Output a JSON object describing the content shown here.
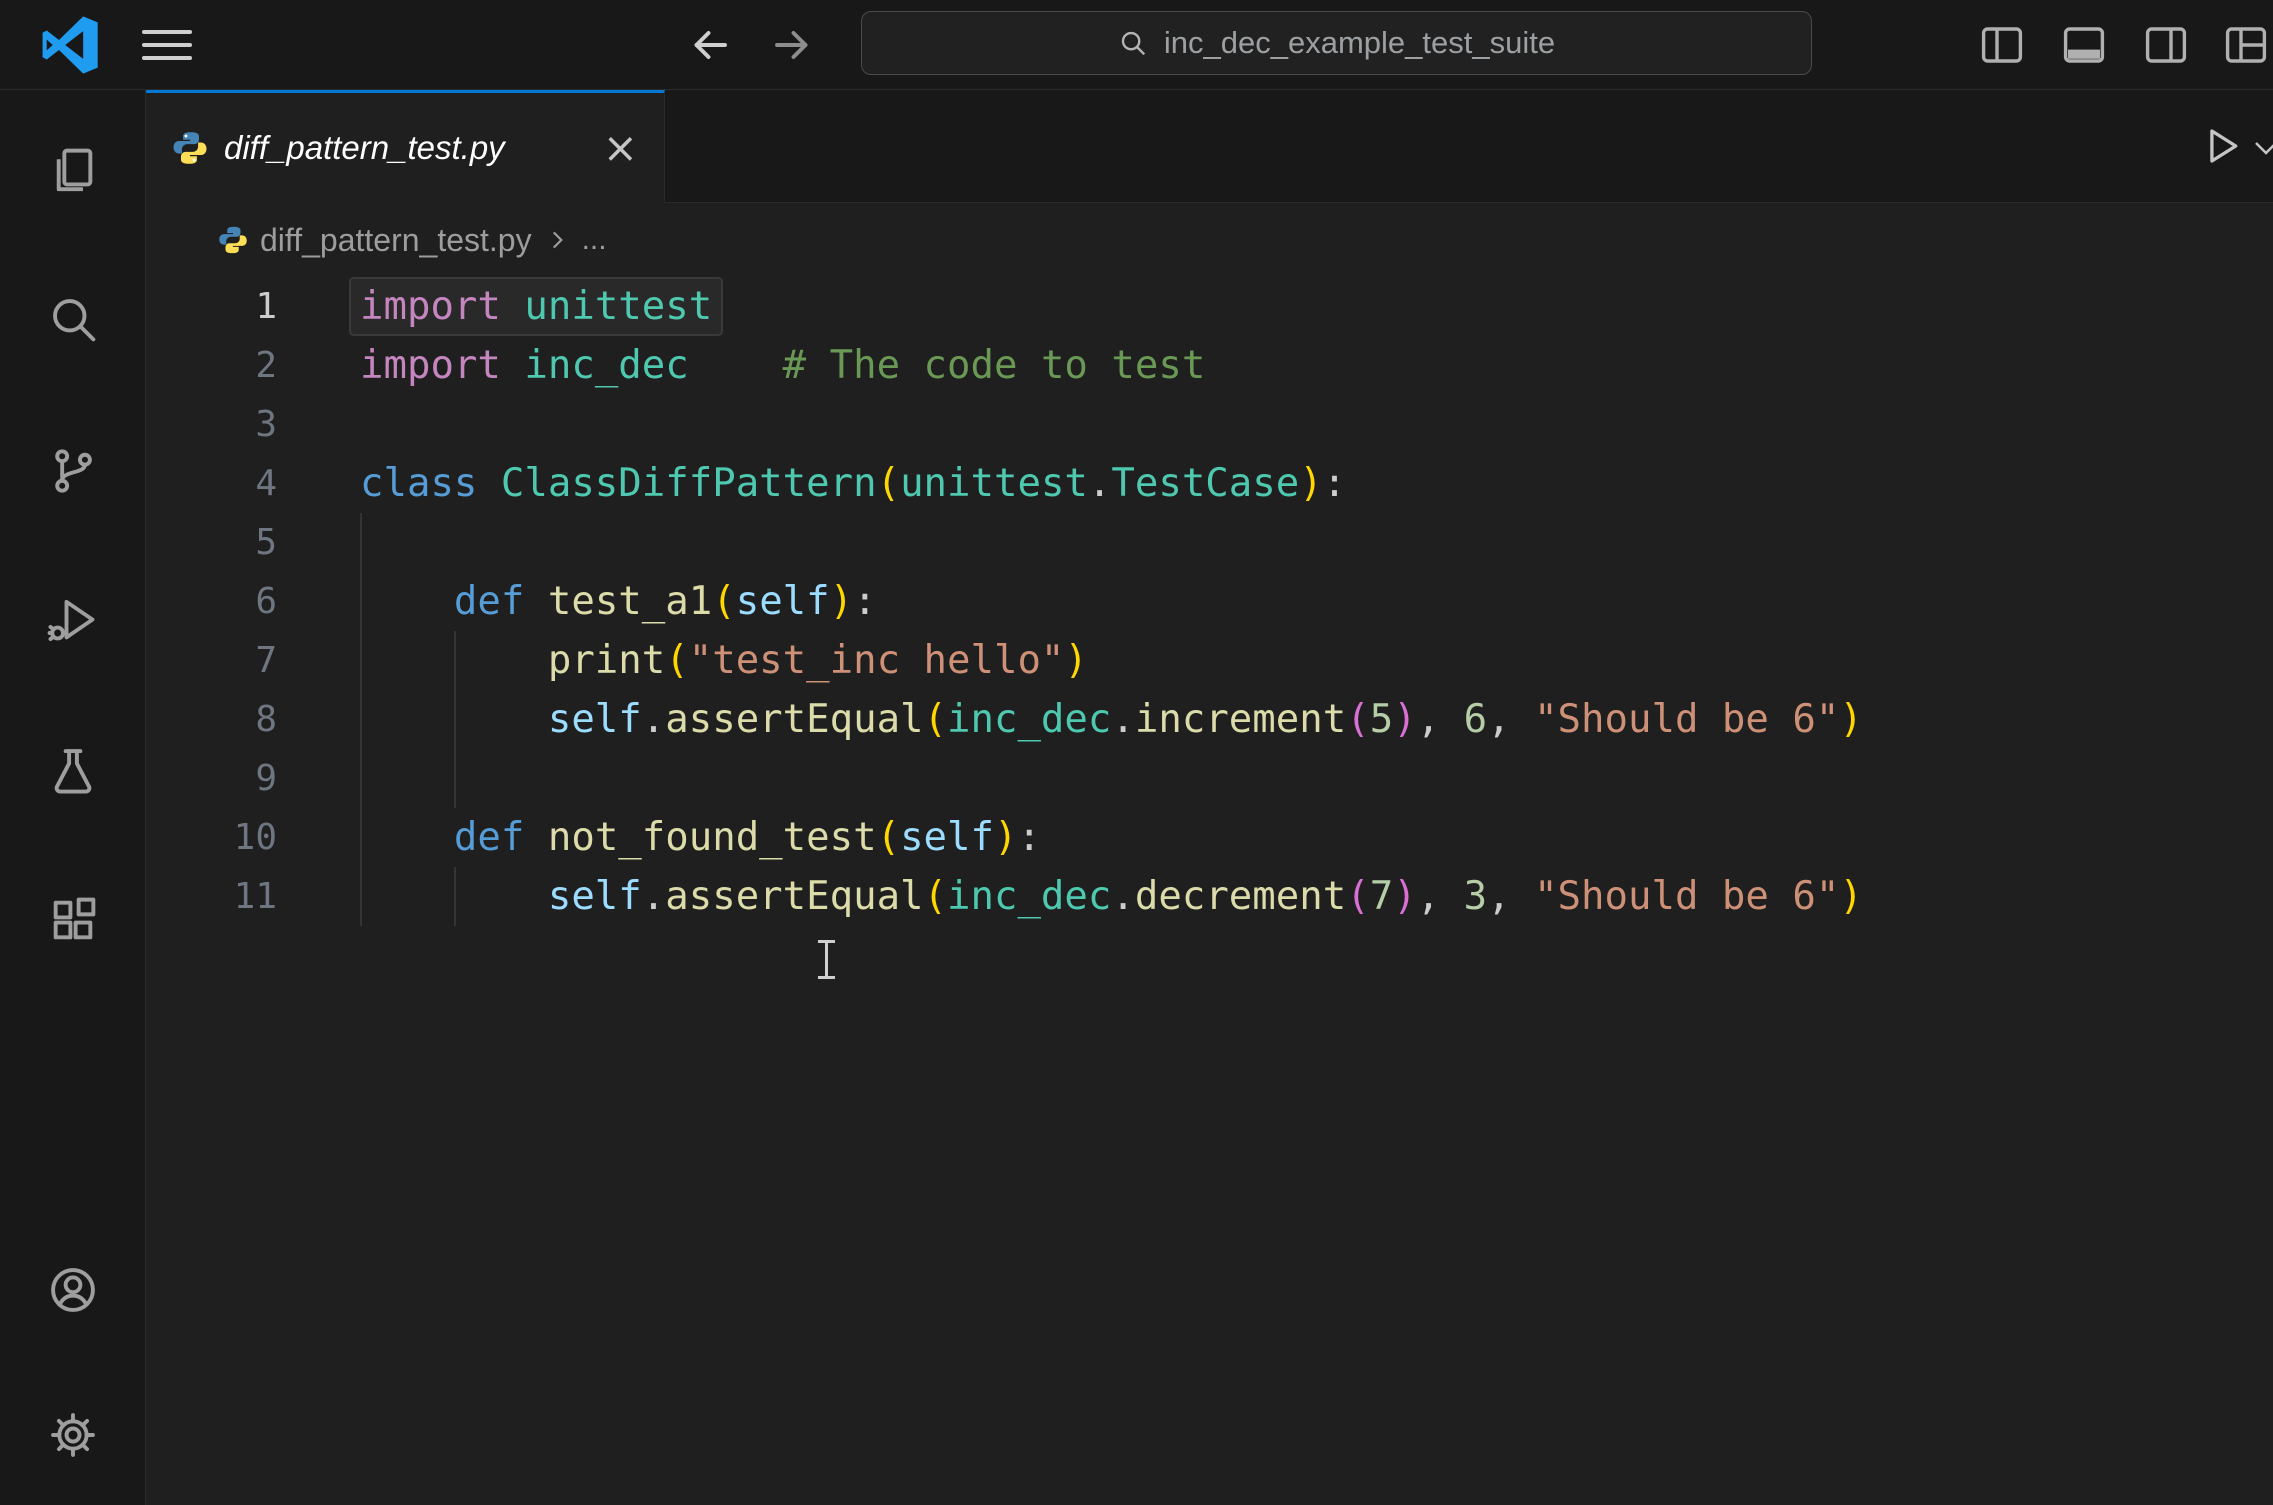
{
  "titlebar": {
    "search_value": "inc_dec_example_test_suite"
  },
  "activity_bar": {
    "items": [
      "explorer",
      "search",
      "source-control",
      "run-and-debug",
      "testing",
      "extensions"
    ],
    "bottom_items": [
      "accounts",
      "manage-settings"
    ]
  },
  "editor": {
    "tab": {
      "title": "diff_pattern_test.py"
    },
    "breadcrumb": {
      "file": "diff_pattern_test.py",
      "more": "..."
    },
    "lines": [
      {
        "num": "1",
        "highlight": true,
        "guides": [],
        "tokens": [
          [
            "kw",
            "import"
          ],
          [
            "def",
            " "
          ],
          [
            "type",
            "unittest"
          ]
        ]
      },
      {
        "num": "2",
        "highlight": false,
        "guides": [],
        "tokens": [
          [
            "kw",
            "import"
          ],
          [
            "def",
            " "
          ],
          [
            "type",
            "inc_dec"
          ],
          [
            "def",
            "    "
          ],
          [
            "com",
            "# The code to test"
          ]
        ]
      },
      {
        "num": "3",
        "highlight": false,
        "guides": [],
        "tokens": []
      },
      {
        "num": "4",
        "highlight": false,
        "guides": [],
        "tokens": [
          [
            "kw2",
            "class"
          ],
          [
            "def",
            " "
          ],
          [
            "type",
            "ClassDiffPattern"
          ],
          [
            "p1",
            "("
          ],
          [
            "type",
            "unittest"
          ],
          [
            "def",
            "."
          ],
          [
            "type",
            "TestCase"
          ],
          [
            "p1",
            ")"
          ],
          [
            "def",
            ":"
          ]
        ]
      },
      {
        "num": "5",
        "highlight": false,
        "guides": [
          0
        ],
        "tokens": []
      },
      {
        "num": "6",
        "highlight": false,
        "guides": [
          0
        ],
        "tokens": [
          [
            "def",
            "    "
          ],
          [
            "kw2",
            "def"
          ],
          [
            "def",
            " "
          ],
          [
            "fn",
            "test_a1"
          ],
          [
            "p1",
            "("
          ],
          [
            "self",
            "self"
          ],
          [
            "p1",
            ")"
          ],
          [
            "def",
            ":"
          ]
        ]
      },
      {
        "num": "7",
        "highlight": false,
        "guides": [
          0,
          4
        ],
        "tokens": [
          [
            "def",
            "        "
          ],
          [
            "fn",
            "print"
          ],
          [
            "p1",
            "("
          ],
          [
            "str",
            "\"test_inc hello\""
          ],
          [
            "p1",
            ")"
          ]
        ]
      },
      {
        "num": "8",
        "highlight": false,
        "guides": [
          0,
          4
        ],
        "tokens": [
          [
            "def",
            "        "
          ],
          [
            "self",
            "self"
          ],
          [
            "def",
            "."
          ],
          [
            "fn",
            "assertEqual"
          ],
          [
            "p1",
            "("
          ],
          [
            "type",
            "inc_dec"
          ],
          [
            "def",
            "."
          ],
          [
            "fn",
            "increment"
          ],
          [
            "p2",
            "("
          ],
          [
            "num",
            "5"
          ],
          [
            "p2",
            ")"
          ],
          [
            "def",
            ", "
          ],
          [
            "num",
            "6"
          ],
          [
            "def",
            ", "
          ],
          [
            "str",
            "\"Should be 6\""
          ],
          [
            "p1",
            ")"
          ]
        ]
      },
      {
        "num": "9",
        "highlight": false,
        "guides": [
          0,
          4
        ],
        "tokens": []
      },
      {
        "num": "10",
        "highlight": false,
        "guides": [
          0
        ],
        "tokens": [
          [
            "def",
            "    "
          ],
          [
            "kw2",
            "def"
          ],
          [
            "def",
            " "
          ],
          [
            "fn",
            "not_found_test"
          ],
          [
            "p1",
            "("
          ],
          [
            "self",
            "self"
          ],
          [
            "p1",
            ")"
          ],
          [
            "def",
            ":"
          ]
        ]
      },
      {
        "num": "11",
        "highlight": false,
        "guides": [
          0,
          4
        ],
        "tokens": [
          [
            "def",
            "        "
          ],
          [
            "self",
            "self"
          ],
          [
            "def",
            "."
          ],
          [
            "fn",
            "assertEqual"
          ],
          [
            "p1",
            "("
          ],
          [
            "type",
            "inc_dec"
          ],
          [
            "def",
            "."
          ],
          [
            "fn",
            "decrement"
          ],
          [
            "p2",
            "("
          ],
          [
            "num",
            "7"
          ],
          [
            "p2",
            ")"
          ],
          [
            "def",
            ", "
          ],
          [
            "num",
            "3"
          ],
          [
            "def",
            ", "
          ],
          [
            "str",
            "\"Should be 6\""
          ],
          [
            "p1",
            ")"
          ]
        ]
      }
    ]
  },
  "icons": {
    "tab_close": "×"
  },
  "colors": {
    "accent": "#0078d4",
    "titlebar_bg": "#181818",
    "editor_bg": "#1f1f1f",
    "tokens": {
      "kw": "#C586C0",
      "kw2": "#569CD6",
      "type": "#4EC9B0",
      "fn": "#DCDCAA",
      "self": "#9CDCFE",
      "str": "#CE9178",
      "num": "#B5CEA8",
      "com": "#6A9955",
      "def": "#CCCCCC",
      "p1": "#FFD700",
      "p2": "#DA70D6"
    }
  }
}
